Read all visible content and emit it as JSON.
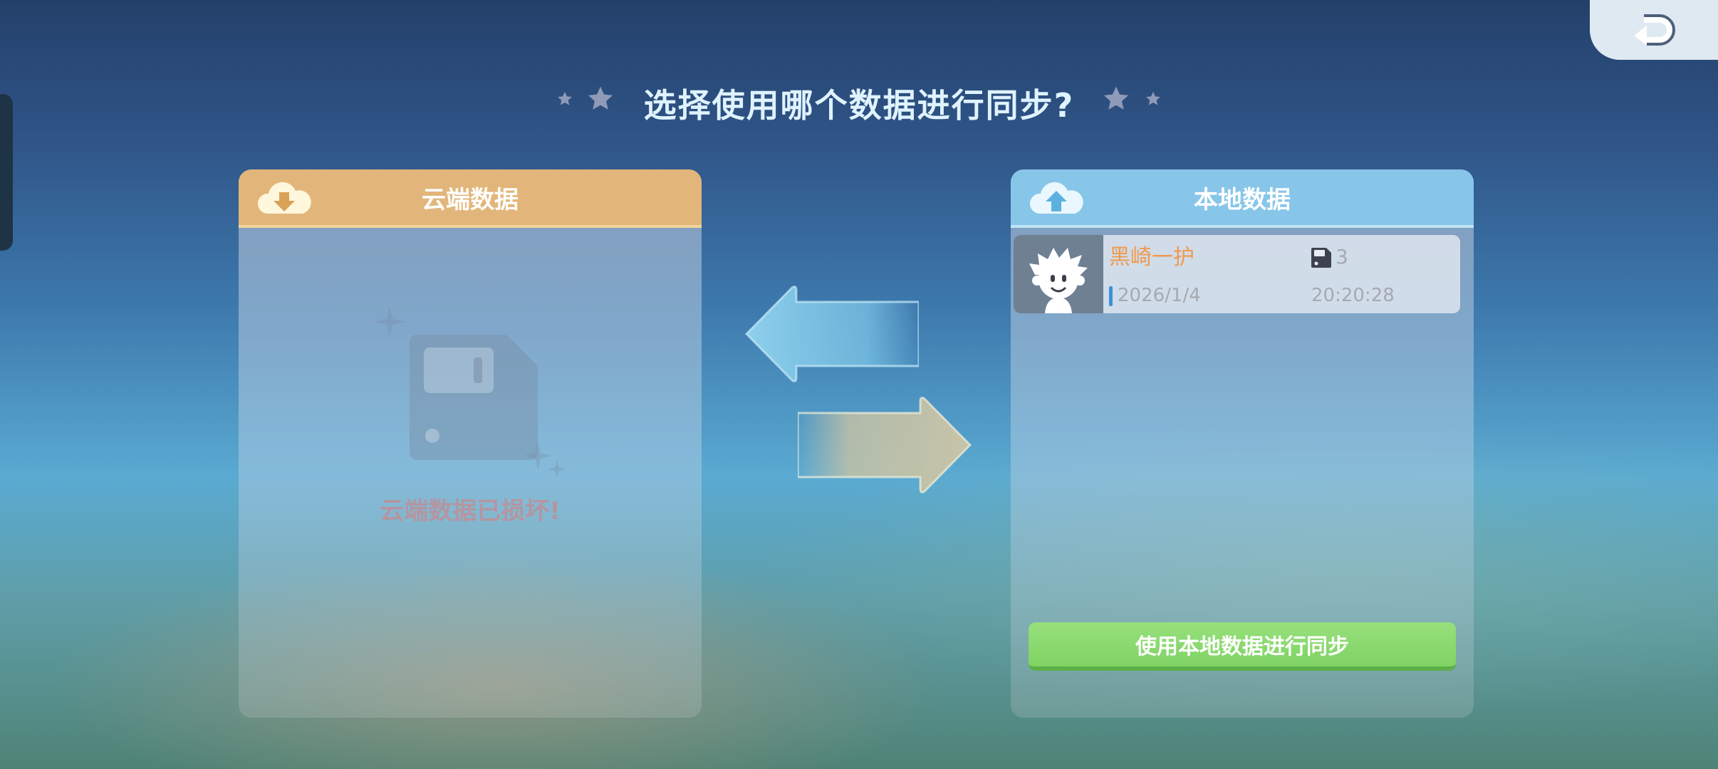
{
  "header": {
    "title": "选择使用哪个数据进行同步?"
  },
  "cloud_panel": {
    "title": "云端数据",
    "status_text": "云端数据已损坏!"
  },
  "local_panel": {
    "title": "本地数据",
    "save": {
      "name": "黑崎一护",
      "slot": "3",
      "date": "2026/1/4",
      "time": "20:20:28"
    },
    "sync_button_label": "使用本地数据进行同步"
  },
  "icons": {
    "back": "back-return-icon",
    "cloud_download": "cloud-download-icon",
    "cloud_upload": "cloud-upload-icon",
    "broken_save": "floppy-disk-icon",
    "slot": "floppy-disk-icon",
    "avatar": "character-avatar-icon",
    "arrow_left": "arrow-left-icon",
    "arrow_right": "arrow-right-icon"
  },
  "colors": {
    "cloud_header": "#e2b67a",
    "local_header": "#87c6e9",
    "sync_button": "#8ad86e",
    "player_name": "#ef9a4d",
    "error_text": "#d77f80"
  }
}
